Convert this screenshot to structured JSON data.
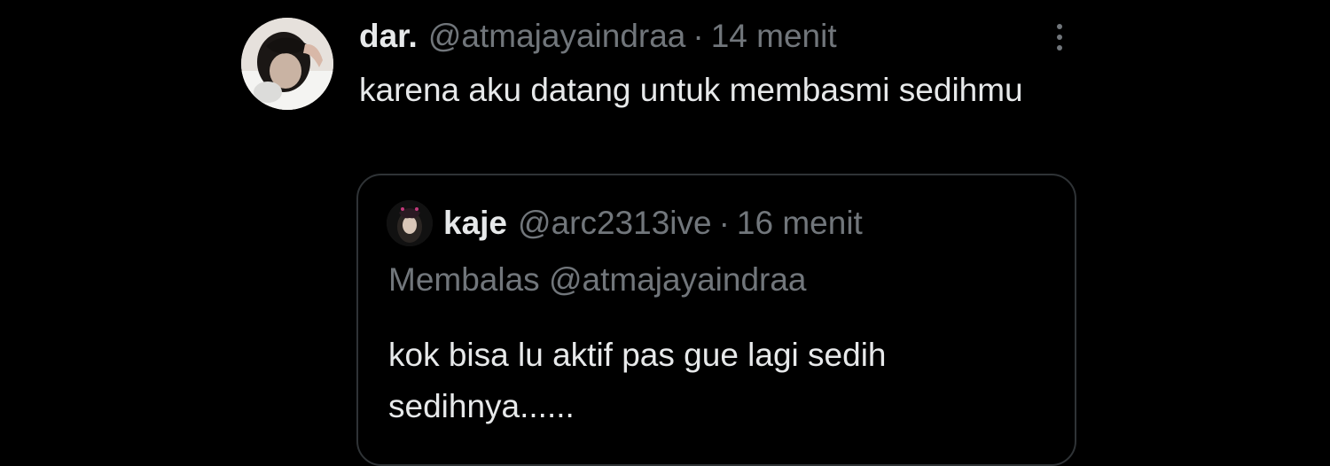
{
  "tweet": {
    "display_name": "dar.",
    "handle": "@atmajayaindraa",
    "separator": "·",
    "time": "14 menit",
    "text": "karena aku datang untuk membasmi sedihmu",
    "more_icon": "more-vertical-icon"
  },
  "quoted_tweet": {
    "display_name": "kaje",
    "handle": "@arc2313ive",
    "separator": "·",
    "time": "16 menit",
    "reply_context": "Membalas @atmajayaindraa",
    "text": "kok bisa lu aktif pas gue lagi sedih sedihnya......"
  },
  "colors": {
    "background": "#000000",
    "primary_text": "#e7e9ea",
    "secondary_text": "#71767b",
    "border": "#2f3336"
  }
}
